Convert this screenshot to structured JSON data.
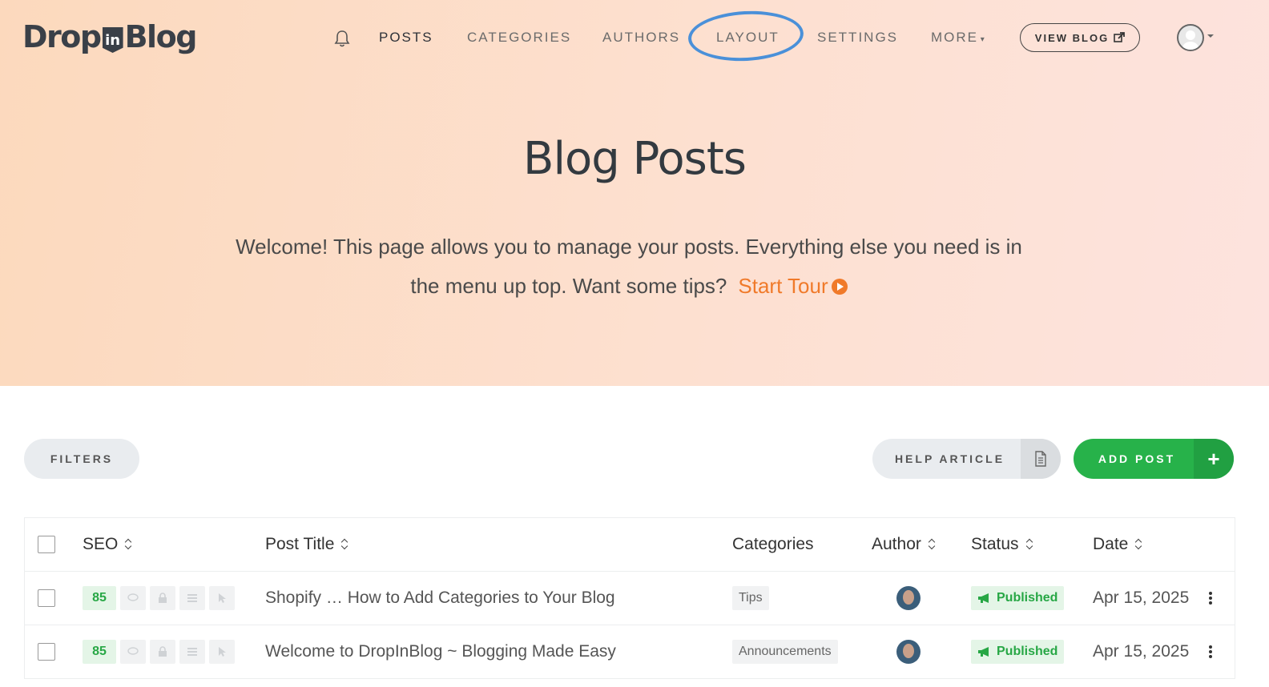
{
  "brand": {
    "drop": "Drop",
    "in": "in",
    "blog": "Blog"
  },
  "nav": {
    "posts": "POSTS",
    "categories": "CATEGORIES",
    "authors": "AUTHORS",
    "layout": "LAYOUT",
    "settings": "SETTINGS",
    "more": "MORE",
    "view_blog": "VIEW BLOG"
  },
  "hero": {
    "title": "Blog Posts",
    "intro": "Welcome! This page allows you to manage your posts. Everything else you need is in the menu up top. Want some tips?",
    "tour": "Start Tour"
  },
  "actions": {
    "filters": "FILTERS",
    "help": "HELP ARTICLE",
    "add": "ADD POST",
    "add_icon": "+"
  },
  "table": {
    "headers": {
      "seo": "SEO",
      "title": "Post Title",
      "categories": "Categories",
      "author": "Author",
      "status": "Status",
      "date": "Date"
    },
    "rows": [
      {
        "seo": "85",
        "title": "Shopify … How to Add Categories to Your Blog",
        "category": "Tips",
        "status": "Published",
        "date": "Apr 15, 2025"
      },
      {
        "seo": "85",
        "title": "Welcome to DropInBlog ~ Blogging Made Easy",
        "category": "Announcements",
        "status": "Published",
        "date": "Apr 15, 2025"
      }
    ]
  },
  "colors": {
    "accent_orange": "#f07a2a",
    "green": "#27b24a",
    "highlight_ring": "#4a90d9"
  }
}
